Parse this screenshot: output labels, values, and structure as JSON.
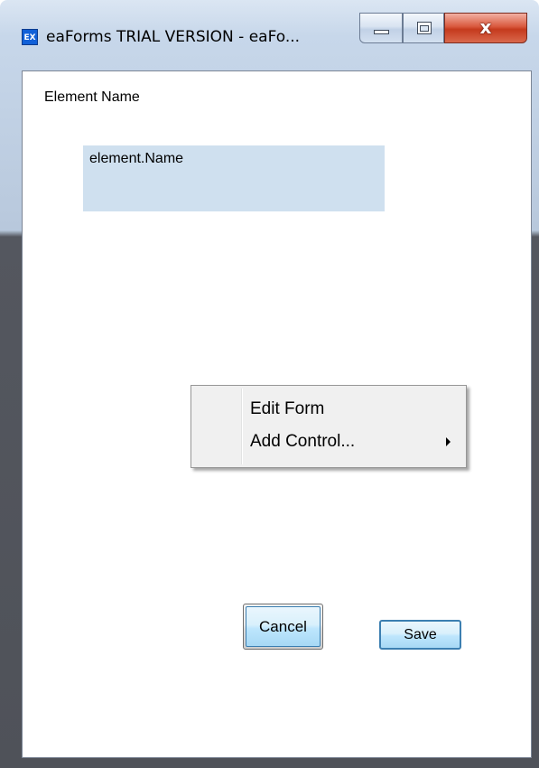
{
  "window": {
    "app_icon_text": "EX",
    "title": "eaForms TRIAL VERSION - eaFo...",
    "caption_buttons": {
      "minimize": "minimize",
      "maximize": "maximize",
      "close": "x"
    }
  },
  "form": {
    "element_name_label": "Element Name",
    "element_name_value": "element.Name"
  },
  "context_menu": {
    "items": [
      {
        "label": "Edit Form",
        "has_submenu": false
      },
      {
        "label": "Add Control...",
        "has_submenu": true
      }
    ]
  },
  "buttons": {
    "cancel_label": "Cancel",
    "save_label": "Save"
  },
  "colors": {
    "field_background": "#cfe0ef",
    "close_button": "#c53a1d",
    "button_highlight": "#3c7fb1"
  }
}
